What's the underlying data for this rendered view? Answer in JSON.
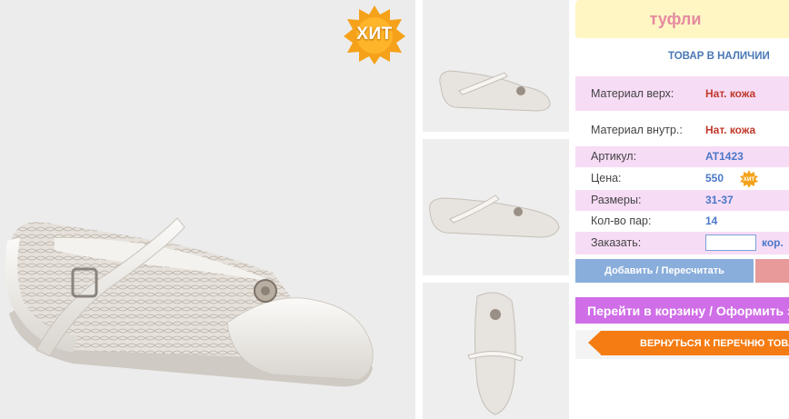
{
  "product": {
    "badge_main": "ХИТ",
    "title": "туфли",
    "stock_status": "ТОВАР В НАЛИЧИИ"
  },
  "specs": {
    "material_upper_label": "Материал верх:",
    "material_upper_value": "Нат. кожа",
    "material_inner_label": "Материал внутр.:",
    "material_inner_value": "Нат. кожа",
    "article_label": "Артикул:",
    "article_value": "AT1423",
    "price_label": "Цена:",
    "price_value": "550",
    "price_badge": "ХИТ",
    "sizes_label": "Размеры:",
    "sizes_value": "31-37",
    "pairs_label": "Кол-во пар:",
    "pairs_value": "14",
    "order_label": "Заказать:",
    "order_value": "",
    "order_unit": "кор."
  },
  "actions": {
    "add_recalc": "Добавить / Пересчитать",
    "to_cart": "Перейти в корзину / Оформить заказ",
    "back_to_list": "ВЕРНУТЬСЯ К ПЕРЕЧНЮ ТОВАРОВ"
  },
  "colors": {
    "title_bg": "#fff6c4",
    "title_text": "#e58aa0",
    "row_pink": "#f7dcf6",
    "link_blue": "#4a78c8",
    "value_red": "#c0392b",
    "cart_purple": "#d06ee8",
    "back_orange": "#f57c12",
    "add_blue": "#8aaedb"
  }
}
